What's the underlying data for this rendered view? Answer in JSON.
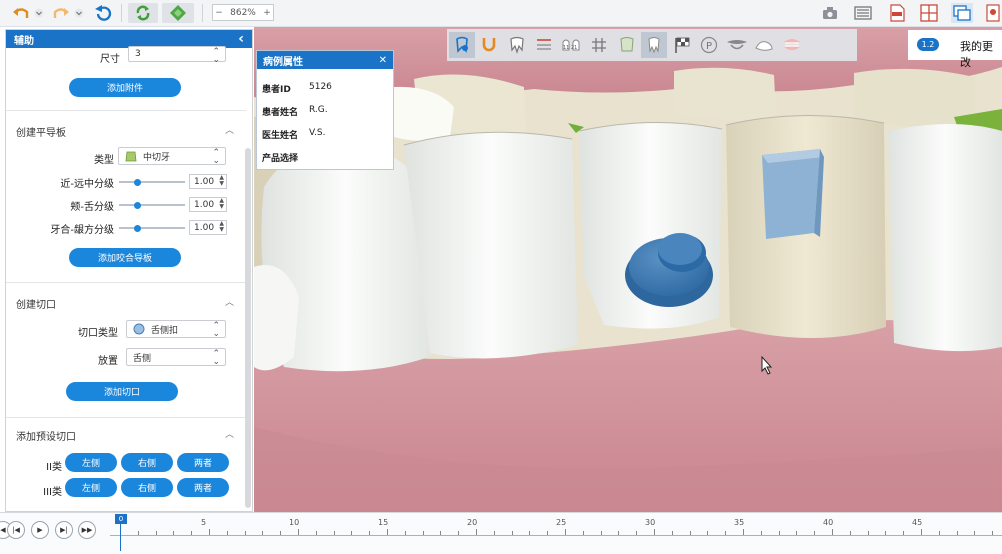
{
  "toolbar": {
    "zoom_value": "862%",
    "zoom_minus": "−",
    "zoom_plus": "+",
    "icons": [
      "undo-icon",
      "undo-dropdown-icon",
      "redo-icon",
      "redo-dropdown-icon",
      "reset-view-icon",
      "refresh-icon",
      "diamond-icon"
    ],
    "right_icons": [
      "camera-icon",
      "list-icon",
      "pdf-icon",
      "split-view-icon",
      "window-icon",
      "export-icon"
    ]
  },
  "left_panel": {
    "header": "辅助",
    "collapse_icon": "‹",
    "size_label": "尺寸",
    "size_value": "3",
    "add_attachment_btn": "添加附件",
    "occlusal_section": {
      "title": "创建平导板",
      "type_label": "类型",
      "type_value": "中切牙",
      "mesiodistal_label": "近-远中分级",
      "mesiodistal_value": "1.00",
      "labial_label": "颊-舌分级",
      "labial_value": "1.00",
      "gingival_label": "牙合-龈方分级",
      "gingival_value": "1.00",
      "add_btn": "添加咬合导板"
    },
    "cut_section": {
      "title": "创建切口",
      "type_label": "切口类型",
      "type_value": "舌侧扣",
      "position_label": "放置",
      "position_value": "舌侧",
      "add_btn": "添加切口"
    },
    "preset_section": {
      "title": "添加预设切口",
      "class2_label": "II类",
      "class3_label": "III类",
      "left_btn": "左侧",
      "right_btn": "右侧",
      "both_btn": "两者"
    }
  },
  "info_panel": {
    "title": "病例属性",
    "close_icon": "✕",
    "patient_id_label": "患者ID",
    "patient_id_value": "5126",
    "patient_name_label": "患者姓名",
    "patient_name_value": "R.G.",
    "doctor_name_label": "医生姓名",
    "doctor_name_value": "V.S.",
    "product_label": "产品选择"
  },
  "tool_tray": [
    "tooth-pin-icon",
    "arch-u-icon",
    "tooth-roots-icon",
    "align-lines-icon",
    "tooth-numbering-icon",
    "grid-icon",
    "tooth-mesh-icon",
    "tooth-single-icon",
    "checkered-flag-icon",
    "p-icon",
    "occlusal-icon",
    "gum-icon",
    "smile-icon"
  ],
  "tooth_numbers": "11 21",
  "right_status": {
    "version_badge": "1.2",
    "my_changes": "我的更改"
  },
  "timeline": {
    "current": "0",
    "ticks": [
      "5",
      "10",
      "15",
      "20",
      "25",
      "30",
      "35",
      "40",
      "45"
    ]
  }
}
